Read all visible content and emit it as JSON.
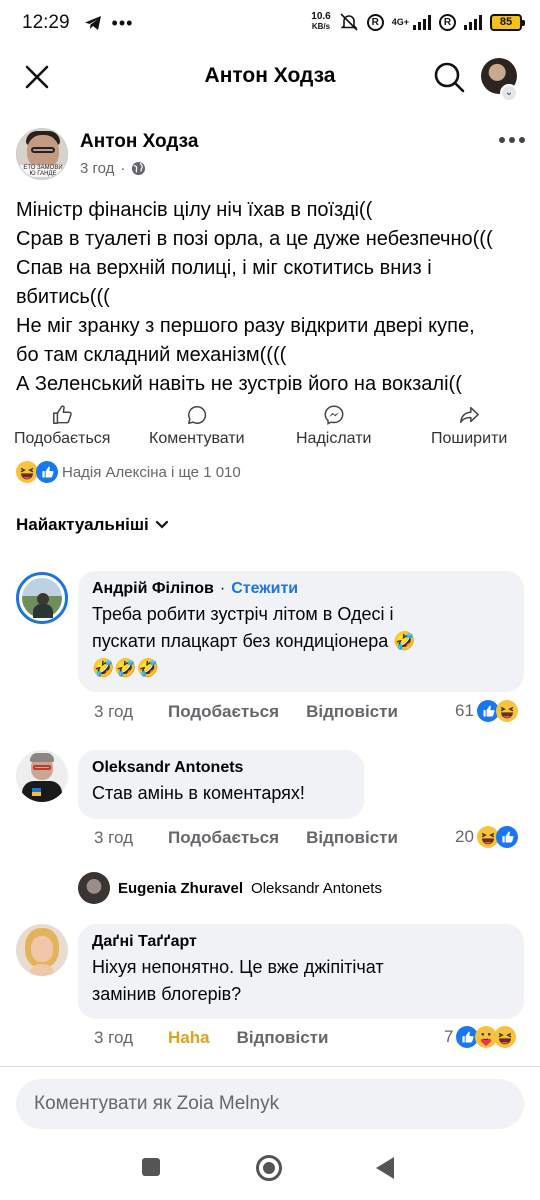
{
  "status_bar": {
    "time": "12:29",
    "net_speed_value": "10.6",
    "net_speed_unit": "KB/s",
    "network_type": "4G+",
    "battery": "85",
    "icons": [
      "telegram-icon",
      "more-dots-icon",
      "mute-icon",
      "registered-icon",
      "signal-icon",
      "battery-icon"
    ]
  },
  "header": {
    "title": "Антон Ходза",
    "icons": [
      "close-icon",
      "search-icon",
      "profile-avatar"
    ]
  },
  "post": {
    "author": "Антон Ходза",
    "avatar_caption": "ЕТО ЗАМОВИ\nЮ ГАНДЕ",
    "time": "3 год",
    "dot": "·",
    "privacy_icon": "globe-icon",
    "lines": [
      "Міністр фінансів цілу ніч їхав в поїзді((",
      "Срав в туалеті в позі орла, а це дуже небезпечно(((",
      "Спав на верхній полиці, і міг скотитись вниз і",
      "вбитись(((",
      "Не міг зранку з першого разу відкрити двері купе,",
      "бо там складний механізм((((",
      "А Зеленський навіть не зустрів його на вокзалі(("
    ],
    "actions": {
      "like": "Подобається",
      "comment": "Коментувати",
      "send": "Надіслати",
      "share": "Поширити"
    },
    "reactions_text": "Надія Алексіна і ще 1 010"
  },
  "sort": {
    "label": "Найактуальніші"
  },
  "comments": [
    {
      "name": "Андрій Філіпов",
      "separator": "·",
      "follow": "Стежити",
      "text_lines": [
        "Треба робити зустріч літом в Одесі і",
        "пускати плацкарт без кондиціонера 🤣",
        "🤣🤣🤣"
      ],
      "time": "3 год",
      "like": "Подобається",
      "reply": "Відповісти",
      "reaction_count": "61"
    },
    {
      "name": "Oleksandr Antonets",
      "text": "Став амінь в коментарях!",
      "time": "3 год",
      "like": "Подобається",
      "reply": "Відповісти",
      "reaction_count": "20"
    },
    {
      "name": "Даґні Таґґарт",
      "text_lines": [
        "Ніхуя непонятно. Це вже джіпітічат",
        "замінив блогерів?"
      ],
      "time": "3 год",
      "like": "Haha",
      "reply": "Відповісти",
      "reaction_count": "7"
    }
  ],
  "reply_preview": {
    "name": "Eugenia Zhuravel",
    "text": "Oleksandr Antonets"
  },
  "comment_input": {
    "placeholder": "Коментувати як Zoia Melnyk"
  },
  "colors": {
    "link": "#1b74e4",
    "haha": "#e0a418",
    "bubble": "#f0f2f5",
    "meta": "#65676b"
  }
}
